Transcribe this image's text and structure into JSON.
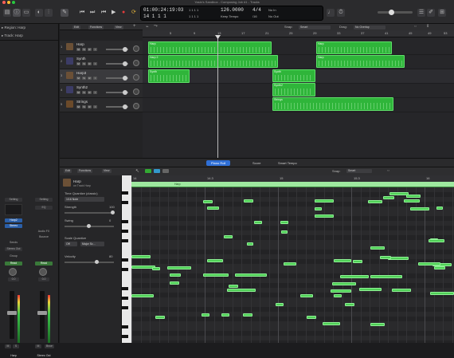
{
  "window": {
    "title": "Yasin's Sandbox - Composing Job #1 - Tracks"
  },
  "toolbar": {
    "tools": [
      "library-icon",
      "inspector-icon",
      "toolbar-icon",
      "smart-controls-icon",
      "mixer-icon",
      "edit-icon"
    ]
  },
  "transport": {
    "rewind": "⏮",
    "fast_forward": "⏭",
    "to_start": "⏮",
    "stop": "■",
    "play": "▶",
    "record": "●",
    "cycle": "⟳"
  },
  "lcd": {
    "time": "01:00:24:19:03",
    "bars": "14  1  1  1",
    "bars_sub": "1  1  1  1",
    "bars_sub2": "1  1  1  1",
    "tempo": "126.0000",
    "keep_tempo": "Keep Tempo",
    "signature": "4/4",
    "division": "/16",
    "no_in": "No In",
    "no_out": "No Out"
  },
  "inspector": {
    "region_label": "▸ Region: Harp",
    "track_label": "▸ Track: Harp",
    "setting_left": "Setting",
    "setting_right": "Setting",
    "eq_left": "EQ",
    "chord_left": "Harp2",
    "chord_right": "Stereo",
    "sends_left": "Sends",
    "stereo_out": "Stereo Out",
    "group_left": "Group",
    "audio_label": "Audio FX",
    "bounce": "Bounce",
    "read_left": "Read",
    "read_right": "Read",
    "pan_left": "0.0",
    "pan_right": "0.0",
    "m_left": "M",
    "s_left": "S",
    "m_right": "M",
    "bnce": "Bnce",
    "name_left": "Harp",
    "name_right": "Stereo Out"
  },
  "tracks_header": {
    "edit": "Edit",
    "functions": "Functions",
    "view": "View"
  },
  "tracks": [
    {
      "num": "1",
      "name": "Harp"
    },
    {
      "num": "2",
      "name": "Synth"
    },
    {
      "num": "3",
      "name": "Harp3"
    },
    {
      "num": "4",
      "name": "Synth2"
    },
    {
      "num": "5",
      "name": "Strings"
    }
  ],
  "arrange_header": {
    "snap_label": "Snap:",
    "snap": "Smart",
    "drag_label": "Drag:",
    "drag": "No Overlap"
  },
  "ruler": [
    "5",
    "9",
    "13",
    "17",
    "21",
    "25",
    "29",
    "33",
    "37",
    "41",
    "45",
    "49",
    "53"
  ],
  "regions": [
    {
      "label": "Harp"
    },
    {
      "label": "Harp 2"
    },
    {
      "label": "Synth"
    },
    {
      "label": "Synth"
    },
    {
      "label": "Synth2"
    },
    {
      "label": "Strings"
    },
    {
      "label": "Harp"
    },
    {
      "label": "Harp"
    }
  ],
  "editor_tabs": {
    "piano": "Piano Roll",
    "score": "Score",
    "smart": "Smart Tempo"
  },
  "piano_header": {
    "edit": "Edit",
    "functions": "Functions",
    "view": "View",
    "snap_label": "Snap:",
    "snap": "Smart"
  },
  "piano_inspector": {
    "region_name": "Harp",
    "region_sub": "on Track Harp",
    "tq_label": "Time Quantize (classic)",
    "tq_value": "1/16 Note",
    "strength": "Strength",
    "strength_val": "100",
    "swing": "Swing",
    "swing_val": "0",
    "sq_label": "Scale Quantize",
    "sq_off": "Off",
    "sq_scale": "Major Sc...",
    "velocity": "Velocity",
    "velocity_val": "80"
  },
  "piano_ruler": [
    "14",
    "14.3",
    "15",
    "15.3",
    "16"
  ],
  "region_bar_label": "Harp",
  "colors": {
    "accent": "#2f6fd6",
    "region": "#2fb53a",
    "note": "#4fcf56"
  }
}
